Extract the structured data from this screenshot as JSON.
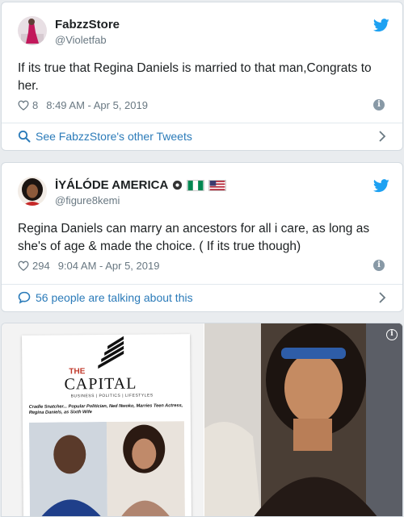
{
  "tweets": [
    {
      "name": "FabzzStore",
      "handle": "@Violetfab",
      "text": "If its true that Regina Daniels is married to that man,Congrats to her.",
      "likes": "8",
      "timestamp": "8:49 AM - Apr 5, 2019",
      "footer_link": "See FabzzStore's other Tweets"
    },
    {
      "name": "İYÁLÓDE AMERICA",
      "handle": "@figure8kemi",
      "text": "Regina Daniels can marry an ancestors for all i care, as long as she's of age & made the choice. ( If its true though)",
      "likes": "294",
      "timestamp": "9:04 AM - Apr 5, 2019",
      "footer_link": "56 people are talking about this"
    }
  ],
  "media": {
    "magazine_the": "THE",
    "magazine_title": "CAPITAL",
    "magazine_subtitle": "BUSINESS | POLITICS | LIFESTYLES",
    "magazine_headline": "Cradle Snatcher... Popular Politician, Ned Nwoko, Marries Teen Actress, Regina Daniels, as Sixth Wife"
  },
  "colors": {
    "twitter_blue": "#1da1f2",
    "link_blue": "#2b7bb9",
    "meta_gray": "#697882"
  },
  "icons": [
    "twitter-bird-icon",
    "heart-icon",
    "info-icon",
    "search-icon",
    "comment-icon",
    "chevron-right-icon",
    "verified-badge-icon",
    "nigeria-flag-icon",
    "usa-flag-icon"
  ]
}
